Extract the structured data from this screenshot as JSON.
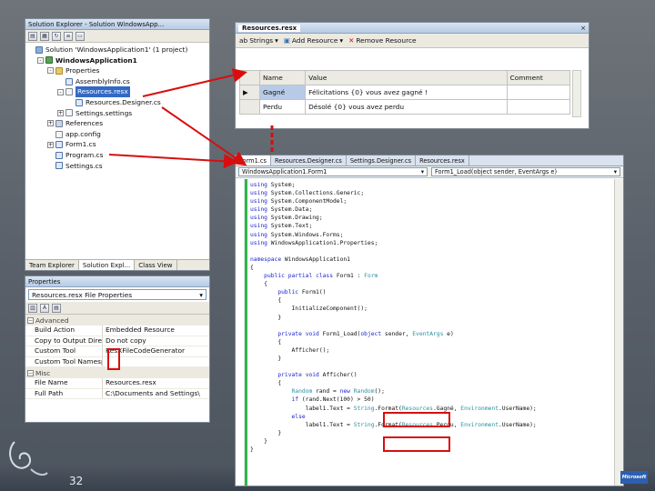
{
  "solution_explorer": {
    "title": "Solution Explorer - Solution WindowsApp...",
    "tree": [
      {
        "label": "Solution 'WindowsApplication1' (1 project)",
        "indent": 0,
        "icon": "solution-icon",
        "expander": ""
      },
      {
        "label": "WindowsApplication1",
        "indent": 1,
        "icon": "project-icon",
        "expander": "-",
        "bold": true
      },
      {
        "label": "Properties",
        "indent": 2,
        "icon": "folder-icon",
        "expander": "-"
      },
      {
        "label": "AssemblyInfo.cs",
        "indent": 3,
        "icon": "cs-file-icon",
        "expander": ""
      },
      {
        "label": "Resources.resx",
        "indent": 3,
        "icon": "resx-file-icon",
        "expander": "-",
        "selected": true
      },
      {
        "label": "Resources.Designer.cs",
        "indent": 4,
        "icon": "cs-file-icon",
        "expander": ""
      },
      {
        "label": "Settings.settings",
        "indent": 3,
        "icon": "settings-file-icon",
        "expander": "+"
      },
      {
        "label": "References",
        "indent": 2,
        "icon": "references-icon",
        "expander": "+"
      },
      {
        "label": "app.config",
        "indent": 2,
        "icon": "config-file-icon",
        "expander": ""
      },
      {
        "label": "Form1.cs",
        "indent": 2,
        "icon": "form-file-icon",
        "expander": "+"
      },
      {
        "label": "Program.cs",
        "indent": 2,
        "icon": "cs-file-icon",
        "expander": ""
      },
      {
        "label": "Settings.cs",
        "indent": 2,
        "icon": "cs-file-icon",
        "expander": ""
      }
    ],
    "bottom_tabs": [
      "Team Explorer",
      "Solution Expl...",
      "Class View"
    ]
  },
  "properties": {
    "title": "Properties",
    "selector": "Resources.resx File Properties",
    "categories": [
      {
        "name": "Advanced",
        "rows": [
          {
            "key": "Build Action",
            "value": "Embedded Resource"
          },
          {
            "key": "Copy to Output Direct",
            "value": "Do not copy"
          },
          {
            "key": "Custom Tool",
            "value": "ResXFileCodeGenerator"
          },
          {
            "key": "Custom Tool Namespace",
            "value": ""
          }
        ]
      },
      {
        "name": "Misc",
        "rows": [
          {
            "key": "File Name",
            "value": "Resources.resx"
          },
          {
            "key": "Full Path",
            "value": "C:\\Documents and Settings\\"
          }
        ]
      }
    ]
  },
  "resources": {
    "tab_label": "Resources.resx",
    "close_glyph": "×",
    "toolbar": {
      "strings_label": "Strings",
      "add_resource_label": "Add Resource",
      "remove_resource_label": "Remove Resource"
    },
    "columns": [
      "Name",
      "Value",
      "Comment"
    ],
    "rows": [
      {
        "marker": "▶",
        "name": "Gagné",
        "value": "Félicitations {0} vous avez gagné !",
        "comment": ""
      },
      {
        "marker": "",
        "name": "Perdu",
        "value": "Désolé {0} vous avez perdu",
        "comment": ""
      }
    ]
  },
  "code_editor": {
    "tabs": [
      "Form1.cs",
      "Resources.Designer.cs",
      "Settings.Designer.cs",
      "Resources.resx"
    ],
    "nav_left": "WindowsApplication1.Form1",
    "nav_right": "Form1_Load(object sender, EventArgs e)",
    "lines": [
      "using System;",
      "using System.Collections.Generic;",
      "using System.ComponentModel;",
      "using System.Data;",
      "using System.Drawing;",
      "using System.Text;",
      "using System.Windows.Forms;",
      "using WindowsApplication1.Properties;",
      "",
      "namespace WindowsApplication1",
      "{",
      "    public partial class Form1 : Form",
      "    {",
      "        public Form1()",
      "        {",
      "            InitializeComponent();",
      "        }",
      "",
      "        private void Form1_Load(object sender, EventArgs e)",
      "        {",
      "            Afficher();",
      "        }",
      "",
      "        private void Afficher()",
      "        {",
      "            Random rand = new Random();",
      "            if (rand.Next(100) > 50)",
      "                label1.Text = String.Format(Resources.Gagné, Environment.UserName);",
      "            else",
      "                label1.Text = String.Format(Resources.Perdu, Environment.UserName);",
      "        }",
      "    }",
      "}"
    ]
  },
  "slide_number": "32",
  "logo_text": "Microsoft",
  "colors": {
    "highlight_red": "#d80e0e",
    "selection_blue": "#316ac5",
    "keyword_blue": "#1b24c9",
    "changed_line_green": "#2db84a"
  }
}
